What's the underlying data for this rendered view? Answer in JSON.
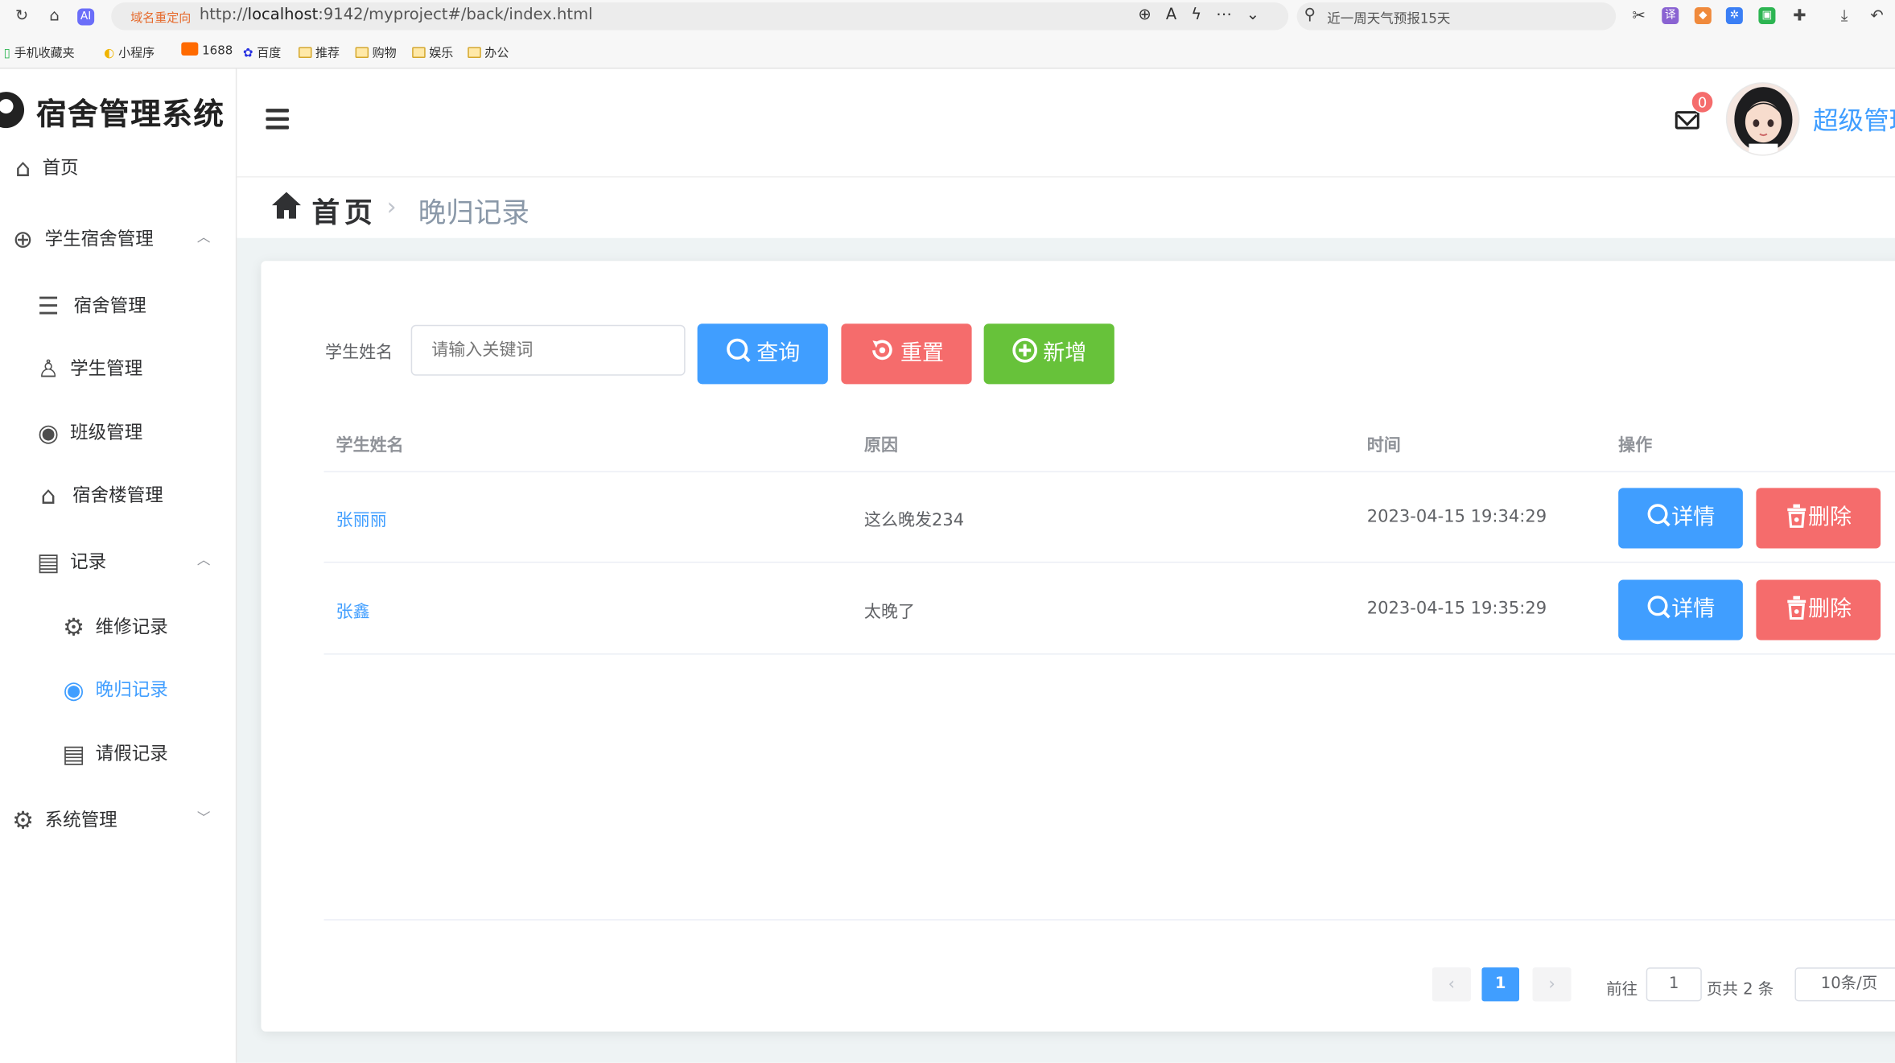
{
  "browser": {
    "redirect_tag": "域名重定向",
    "url_prefix": "http://",
    "url_host": "localhost",
    "url_rest": ":9142/myproject#/back/index.html",
    "search_text": "近一周天气预报15天",
    "bookmarks": [
      "手机收藏夹",
      "小程序",
      "1688",
      "百度",
      "推荐",
      "购物",
      "娱乐",
      "办公"
    ]
  },
  "app": {
    "title": "宿舍管理系统",
    "user_name": "超级管理员",
    "unread_count": "0"
  },
  "sidebar": {
    "items": [
      {
        "label": "首页",
        "icon": "home-icon"
      },
      {
        "label": "学生宿舍管理",
        "icon": "plus-circle-icon"
      },
      {
        "label": "宿舍管理",
        "icon": "list-icon"
      },
      {
        "label": "学生管理",
        "icon": "user-icon"
      },
      {
        "label": "班级管理",
        "icon": "drop-icon"
      },
      {
        "label": "宿舍楼管理",
        "icon": "house-icon"
      },
      {
        "label": "记录",
        "icon": "document-icon"
      },
      {
        "label": "维修记录",
        "icon": "gear-icon"
      },
      {
        "label": "晚归记录",
        "icon": "drop-icon"
      },
      {
        "label": "请假记录",
        "icon": "document-icon"
      },
      {
        "label": "系统管理",
        "icon": "gear-icon"
      }
    ]
  },
  "breadcrumb": {
    "home": "首页",
    "current": "晚归记录"
  },
  "filter": {
    "label": "学生姓名",
    "placeholder": "请输入关键词",
    "query": "查询",
    "reset": "重置",
    "add": "新增"
  },
  "table": {
    "columns": [
      "学生姓名",
      "原因",
      "时间",
      "操作"
    ],
    "rows": [
      {
        "name": "张丽丽",
        "reason": "这么晚发234",
        "time": "2023-04-15 19:34:29"
      },
      {
        "name": "张鑫",
        "reason": "太晚了",
        "time": "2023-04-15 19:35:29"
      }
    ],
    "detail_label": "详情",
    "delete_label": "删除"
  },
  "pagination": {
    "current_page": "1",
    "goto_label": "前往",
    "goto_value": "1",
    "total_text": "页共 2 条",
    "page_size": "10条/页",
    "prev": "‹",
    "next": "›"
  },
  "colors": {
    "primary": "#409eff",
    "danger": "#f56c6c",
    "success": "#67c23a"
  }
}
